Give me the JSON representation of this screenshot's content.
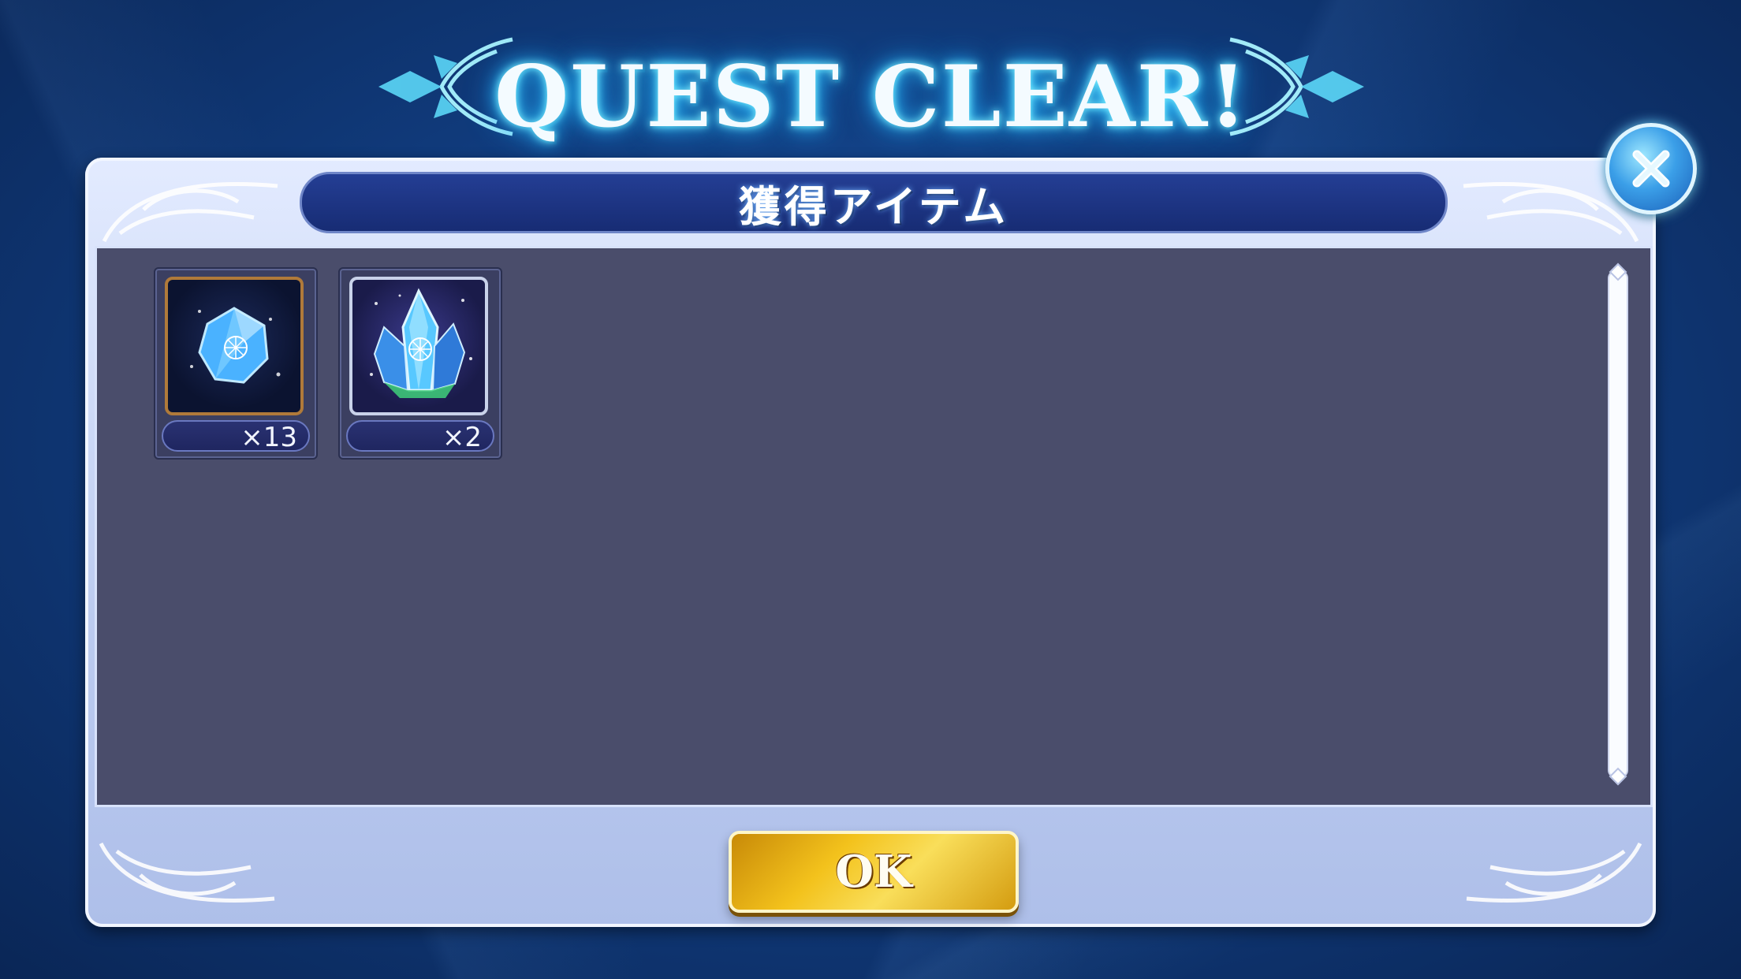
{
  "banner": {
    "title": "QUEST CLEAR!"
  },
  "panel": {
    "header": "獲得アイテム"
  },
  "items": [
    {
      "name": "crystal-orb",
      "count": "×13"
    },
    {
      "name": "crystal-cluster",
      "count": "×2"
    }
  ],
  "actions": {
    "ok_label": "OK"
  },
  "colors": {
    "accent": "#f3c21c",
    "panel_bg": "#4a4d6b",
    "header_bg": "#172c74"
  }
}
